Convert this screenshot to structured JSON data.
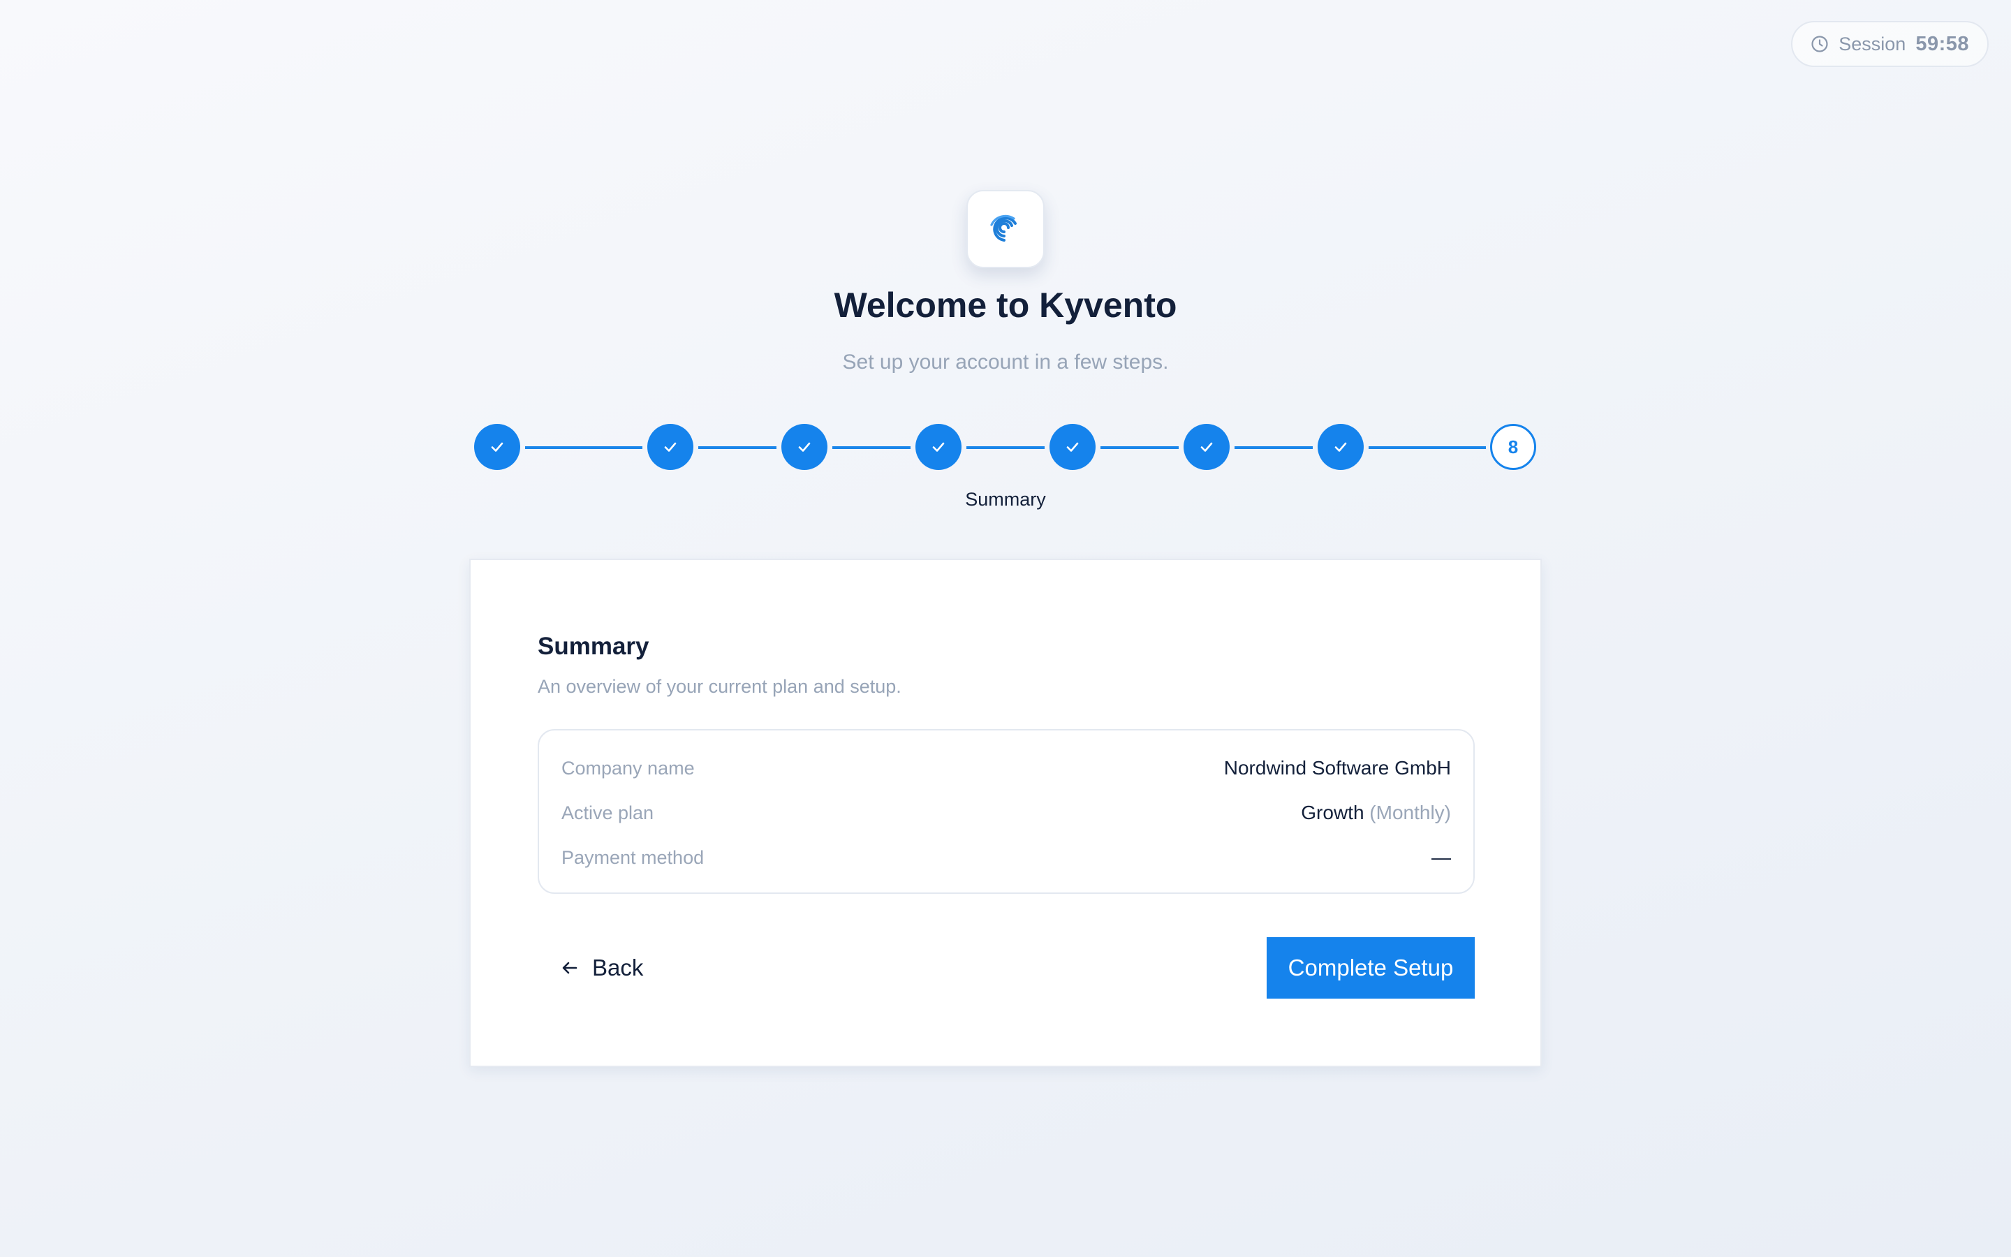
{
  "session": {
    "label": "Session",
    "time": "59:58",
    "icon": "clock-icon"
  },
  "header": {
    "logo_icon": "kyvento-logo-icon",
    "title": "Welcome to Kyvento",
    "subtitle": "Set up your account in a few steps."
  },
  "stepper": {
    "total_steps": 8,
    "completed_steps": 7,
    "current_step_number": "8",
    "current_step_label": "Summary",
    "accent_color": "#1583ec"
  },
  "card": {
    "title": "Summary",
    "description": "An overview of your current plan and setup.",
    "rows": [
      {
        "label": "Company name",
        "value": "Nordwind Software GmbH",
        "note": ""
      },
      {
        "label": "Active plan",
        "value": "Growth",
        "note": "(Monthly)"
      },
      {
        "label": "Payment method",
        "value": "—",
        "note": ""
      }
    ],
    "back_label": "Back",
    "complete_label": "Complete Setup"
  }
}
